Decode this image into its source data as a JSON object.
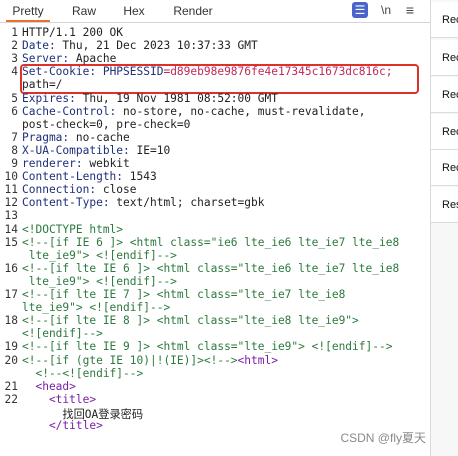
{
  "tabs": [
    "Pretty",
    "Raw",
    "Hex",
    "Render"
  ],
  "toolbar": {
    "list_icon": "list-icon",
    "newline_label": "\\n",
    "menu_icon": "hamburger-menu-icon"
  },
  "side_items": [
    "Rec",
    "Rec",
    "Rec",
    "Rec",
    "Rec",
    "Res"
  ],
  "lines": [
    {
      "n": "1",
      "segs": [
        {
          "t": "HTTP/1.1 200 OK",
          "c": "v"
        }
      ]
    },
    {
      "n": "2",
      "segs": [
        {
          "t": "Date: ",
          "c": "k"
        },
        {
          "t": "Thu, 21 Dec 2023 10:37:33 GMT",
          "c": "v"
        }
      ]
    },
    {
      "n": "3",
      "segs": [
        {
          "t": "Server: ",
          "c": "k"
        },
        {
          "t": "Apache",
          "c": "v"
        }
      ]
    },
    {
      "n": "4",
      "segs": [
        {
          "t": "Set-Cookie: ",
          "c": "k"
        },
        {
          "t": "PHPSESSID",
          "c": "k"
        },
        {
          "t": "=d89eb98e9876fe4e17345c1673dc816c;",
          "c": "cv"
        }
      ]
    },
    {
      "n": "",
      "segs": [
        {
          "t": "path=/",
          "c": "v"
        }
      ]
    },
    {
      "n": "5",
      "segs": [
        {
          "t": "Expires: ",
          "c": "k"
        },
        {
          "t": "Thu, 19 Nov 1981 08:52:00 GMT",
          "c": "v"
        }
      ]
    },
    {
      "n": "6",
      "segs": [
        {
          "t": "Cache-Control: ",
          "c": "k"
        },
        {
          "t": "no-store, no-cache, must-revalidate,",
          "c": "v"
        }
      ]
    },
    {
      "n": "",
      "segs": [
        {
          "t": "post-check=0, pre-check=0",
          "c": "v"
        }
      ]
    },
    {
      "n": "7",
      "segs": [
        {
          "t": "Pragma: ",
          "c": "k"
        },
        {
          "t": "no-cache",
          "c": "v"
        }
      ]
    },
    {
      "n": "8",
      "segs": [
        {
          "t": "X-UA-Compatible: ",
          "c": "k"
        },
        {
          "t": "IE=10",
          "c": "v"
        }
      ]
    },
    {
      "n": "9",
      "segs": [
        {
          "t": "renderer: ",
          "c": "k"
        },
        {
          "t": "webkit",
          "c": "v"
        }
      ]
    },
    {
      "n": "10",
      "segs": [
        {
          "t": "Content-Length: ",
          "c": "k"
        },
        {
          "t": "1543",
          "c": "v"
        }
      ]
    },
    {
      "n": "11",
      "segs": [
        {
          "t": "Connection: ",
          "c": "k"
        },
        {
          "t": "close",
          "c": "v"
        }
      ]
    },
    {
      "n": "12",
      "segs": [
        {
          "t": "Content-Type: ",
          "c": "k"
        },
        {
          "t": "text/html; charset=gbk",
          "c": "v"
        }
      ]
    },
    {
      "n": "13",
      "segs": []
    },
    {
      "n": "14",
      "segs": [
        {
          "t": "<!DOCTYPE html>",
          "c": "tag"
        }
      ]
    },
    {
      "n": "15",
      "segs": [
        {
          "t": "<!--[if IE 6 ]> <html class=\"ie6 lte_ie6 lte_ie7 lte_ie8",
          "c": "tag"
        }
      ]
    },
    {
      "n": "",
      "segs": [
        {
          "t": " lte_ie9\"> <![endif]-->",
          "c": "tag"
        }
      ]
    },
    {
      "n": "16",
      "segs": [
        {
          "t": "<!--[if lte IE 6 ]> <html class=\"lte_ie6 lte_ie7 lte_ie8",
          "c": "tag"
        }
      ]
    },
    {
      "n": "",
      "segs": [
        {
          "t": " lte_ie9\"> <![endif]-->",
          "c": "tag"
        }
      ]
    },
    {
      "n": "17",
      "segs": [
        {
          "t": "<!--[if lte IE 7 ]> <html class=\"lte_ie7 lte_ie8",
          "c": "tag"
        }
      ]
    },
    {
      "n": "",
      "segs": [
        {
          "t": "lte_ie9\"> <![endif]-->",
          "c": "tag"
        }
      ]
    },
    {
      "n": "18",
      "segs": [
        {
          "t": "<!--[if lte IE 8 ]> <html class=\"lte_ie8 lte_ie9\">",
          "c": "tag"
        }
      ]
    },
    {
      "n": "",
      "segs": [
        {
          "t": "<![endif]-->",
          "c": "tag"
        }
      ]
    },
    {
      "n": "19",
      "segs": [
        {
          "t": "<!--[if lte IE 9 ]> <html class=\"lte_ie9\"> <![endif]-->",
          "c": "tag"
        }
      ]
    },
    {
      "n": "20",
      "segs": [
        {
          "t": "<!--[if (gte IE 10)|!(IE)]><!-->",
          "c": "tag"
        },
        {
          "t": "<html>",
          "c": "tagp"
        }
      ]
    },
    {
      "n": "",
      "segs": [
        {
          "t": "  <!--<![endif]-->",
          "c": "tag"
        }
      ]
    },
    {
      "n": "21",
      "segs": [
        {
          "t": "  <head>",
          "c": "tagp"
        }
      ]
    },
    {
      "n": "22",
      "segs": [
        {
          "t": "    <title>",
          "c": "tagp"
        }
      ]
    },
    {
      "n": "",
      "segs": [
        {
          "t": "      找回OA登录密码",
          "c": "v"
        }
      ]
    },
    {
      "n": "",
      "segs": [
        {
          "t": "    </title>",
          "c": "tagp"
        }
      ]
    }
  ],
  "watermark": "CSDN @fly夏天"
}
